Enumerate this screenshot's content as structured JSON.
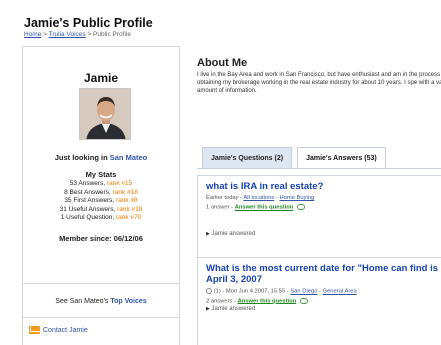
{
  "header": {
    "title": "Jamie's Public Profile",
    "breadcrumb": [
      "Home",
      "Trulia Voices",
      "Public Profile"
    ],
    "breadcrumb_sep": ">"
  },
  "profile": {
    "name": "Jamie",
    "status_prefix": "Just looking in",
    "status_location": "San Mateo",
    "stats_title": "My Stats",
    "stats": [
      {
        "text": "53 Answers,",
        "rank": "rank #15"
      },
      {
        "text": "8 Best Answers,",
        "rank": "rank #18"
      },
      {
        "text": "35 First Answers,",
        "rank": "rank #8"
      },
      {
        "text": "31 Useful Answers,",
        "rank": "rank #18"
      },
      {
        "text": "1 Useful Question,",
        "rank": "rank #70"
      }
    ],
    "member_since": "Member since: 06/12/06",
    "top_voices_prefix": "See San Mateo's",
    "top_voices_link": "Top Voices",
    "contact": "Contact Jamie"
  },
  "about": {
    "title": "About Me",
    "text": "I live in the Bay Area and work in San Francisco, but have enthusiast and am in the process of obtaining my brokerage working in the real estate industry for about 10 years. I spe with a vast amount of information."
  },
  "tabs": [
    {
      "label": "Jamie's Questions (2)",
      "active": false
    },
    {
      "label": "Jamie's Answers (53)",
      "active": true
    }
  ],
  "questions": [
    {
      "title": "what is IRA in real estate?",
      "meta_prefix": "Earlier today -",
      "meta_links": [
        "All locations",
        "Home Buying"
      ],
      "answers_prefix": "1 answer -",
      "answer_link": "Answer this question",
      "answered": "Jamie answered"
    },
    {
      "title": "What is the most current date for \"Home can find is April 3, 2007",
      "meta_prefix": "(1) - Mon Jun 4 2007, 15:55 -",
      "meta_links": [
        "San Diego",
        "General Area"
      ],
      "answers_prefix": "2 answers -",
      "answer_link": "Answer this question",
      "answered": "Jamie answered"
    }
  ]
}
